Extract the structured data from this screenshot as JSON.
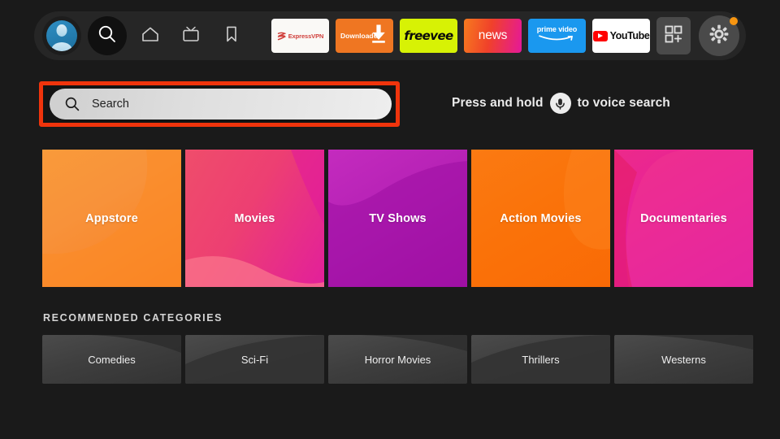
{
  "background_color": "#1a1a1a",
  "topbar": {
    "profile": {
      "name": "profile-avatar",
      "label": "Profile"
    },
    "nav_items": [
      {
        "icon": "search-icon",
        "label": "Search",
        "selected": true
      },
      {
        "icon": "home-icon",
        "label": "Home",
        "selected": false
      },
      {
        "icon": "live-tv-icon",
        "label": "Live TV",
        "selected": false
      },
      {
        "icon": "bookmark-icon",
        "label": "Watchlist",
        "selected": false
      }
    ],
    "apps": [
      {
        "id": "expressvpn",
        "label": "ExpressVPN",
        "bg": "#faf9f6"
      },
      {
        "id": "downloader",
        "label": "Downloader",
        "bg": "#ef7622"
      },
      {
        "id": "freevee",
        "label": "freevee",
        "bg": "#d7f205"
      },
      {
        "id": "news",
        "label": "news",
        "bg": "#f0412a"
      },
      {
        "id": "prime-video",
        "label": "prime video",
        "bg": "#1a98ef"
      },
      {
        "id": "youtube",
        "label": "YouTube",
        "bg": "#ffffff"
      }
    ],
    "apps_grid_button": {
      "icon": "apps-grid-plus-icon",
      "label": "Apps"
    },
    "settings_button": {
      "icon": "gear-icon",
      "label": "Settings",
      "notification_dot": true,
      "dot_color": "#f79510"
    }
  },
  "search": {
    "placeholder": "Search",
    "value": "",
    "icon": "magnifier-icon",
    "highlight_color": "#f0340c",
    "highlighted": true
  },
  "voice": {
    "text_before": "Press and hold",
    "icon": "microphone-icon",
    "text_after": "to voice search"
  },
  "featured": {
    "tiles": [
      {
        "label": "Appstore",
        "color": "#f9883a"
      },
      {
        "label": "Movies",
        "color": "#ea3c7e"
      },
      {
        "label": "TV Shows",
        "color": "#b521b5"
      },
      {
        "label": "Action Movies",
        "color": "#fa7209"
      },
      {
        "label": "Documentaries",
        "color": "#e8219a"
      }
    ]
  },
  "recommended": {
    "heading": "RECOMMENDED CATEGORIES",
    "tiles": [
      {
        "label": "Comedies"
      },
      {
        "label": "Sci-Fi"
      },
      {
        "label": "Horror Movies"
      },
      {
        "label": "Thrillers"
      },
      {
        "label": "Westerns"
      }
    ]
  }
}
